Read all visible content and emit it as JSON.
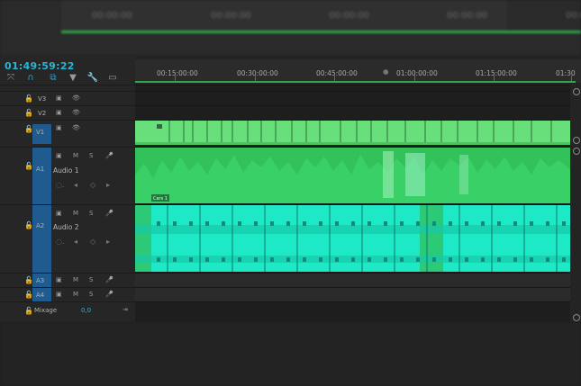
{
  "top_monitor": {
    "ruler_labels": [
      "00:00:00",
      "00:00:00",
      "00:00:00",
      "00:00:00",
      "00:00:00"
    ]
  },
  "timeline": {
    "timecode": "01:49:59:22",
    "toolbar_icons": [
      "snap-icon",
      "magnet-icon",
      "linked-selection-icon",
      "marker-icon",
      "wrench-icon",
      "captions-icon"
    ],
    "ruler_labels": [
      "00:15:00:00",
      "00:30:00:00",
      "00:45:00:00",
      "01:00:00:00",
      "01:15:00:00",
      "01:30"
    ],
    "tracks": {
      "v3": {
        "name": "V3"
      },
      "v2": {
        "name": "V2"
      },
      "v1": {
        "name": "V1"
      },
      "a1": {
        "name": "A1",
        "label": "Audio 1",
        "mute": "M",
        "solo": "S"
      },
      "a2": {
        "name": "A2",
        "label": "Audio 2",
        "mute": "M",
        "solo": "S"
      },
      "a3": {
        "name": "A3",
        "mute": "M",
        "solo": "S"
      },
      "a4": {
        "name": "A4",
        "mute": "M",
        "solo": "S"
      },
      "mix": {
        "label": "Mixage",
        "value": "0,0"
      }
    },
    "clip_labels": {
      "audio1_first": "Cars 1"
    },
    "colors": {
      "video_clip": "#67e07b",
      "audio1_clip": "#33c25a",
      "audio2_clip": "#1de9c6",
      "target_blue": "#1f5b8f",
      "timecode": "#29b6d6",
      "playbar": "#2fa84a"
    }
  }
}
